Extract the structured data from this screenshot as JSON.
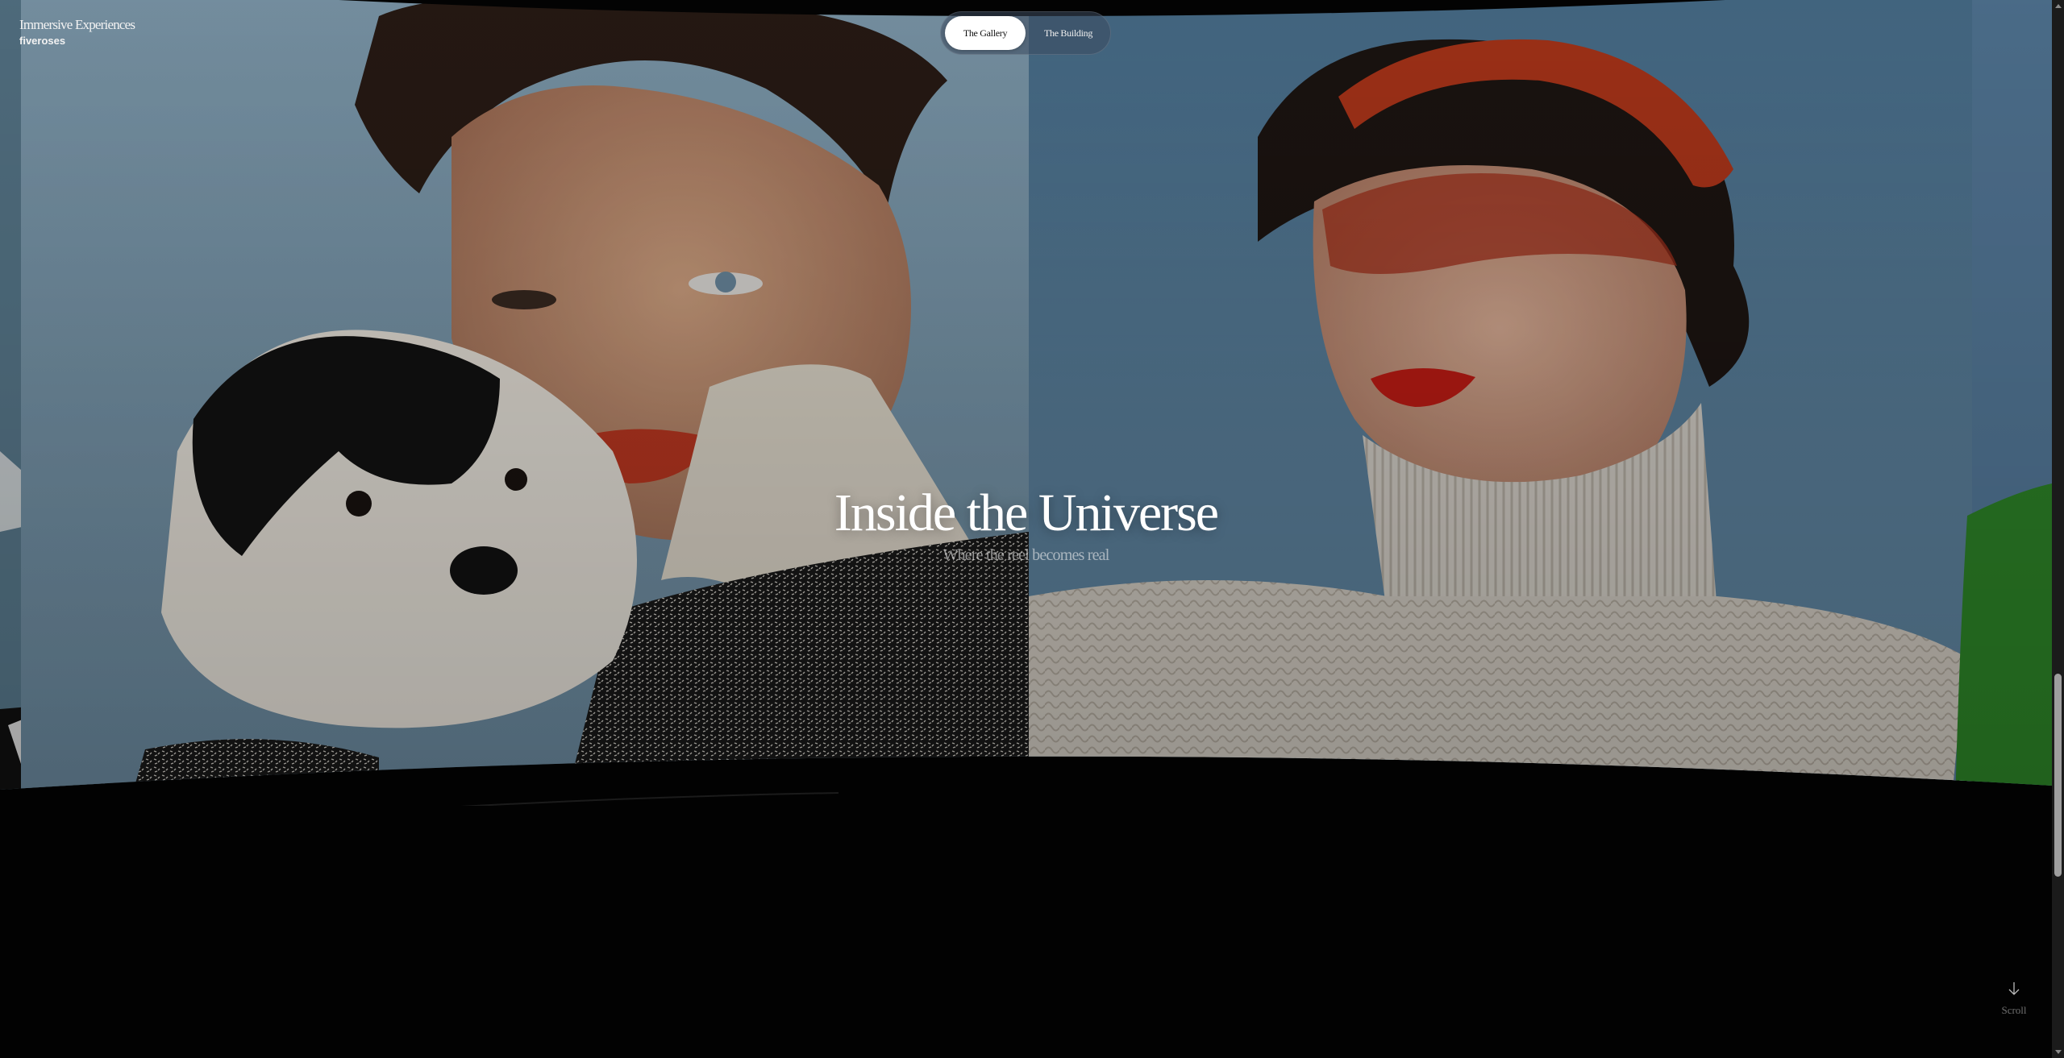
{
  "brand": {
    "title": "Immersive Experiences",
    "subtitle": "fiveroses"
  },
  "nav": {
    "tabs": [
      {
        "label": "The Gallery",
        "active": true
      },
      {
        "label": "The Building",
        "active": false
      }
    ]
  },
  "hero": {
    "title": "Inside the Universe",
    "subtitle": "Where the reel becomes real"
  },
  "scroll": {
    "label": "Scroll",
    "icon": "arrow-down-icon"
  },
  "gallery": {
    "panels": [
      {
        "name": "portrait-with-puppy",
        "description_icon": "photo"
      },
      {
        "name": "portrait-red-headband",
        "description_icon": "photo"
      }
    ]
  },
  "colors": {
    "background": "#000000",
    "sky_left": "#7d9db3",
    "sky_right": "#5d86a7",
    "lips": "#c23a22",
    "headband": "#b8391c",
    "sweater": "#e6e1da",
    "nav_active_bg": "#ffffff"
  }
}
